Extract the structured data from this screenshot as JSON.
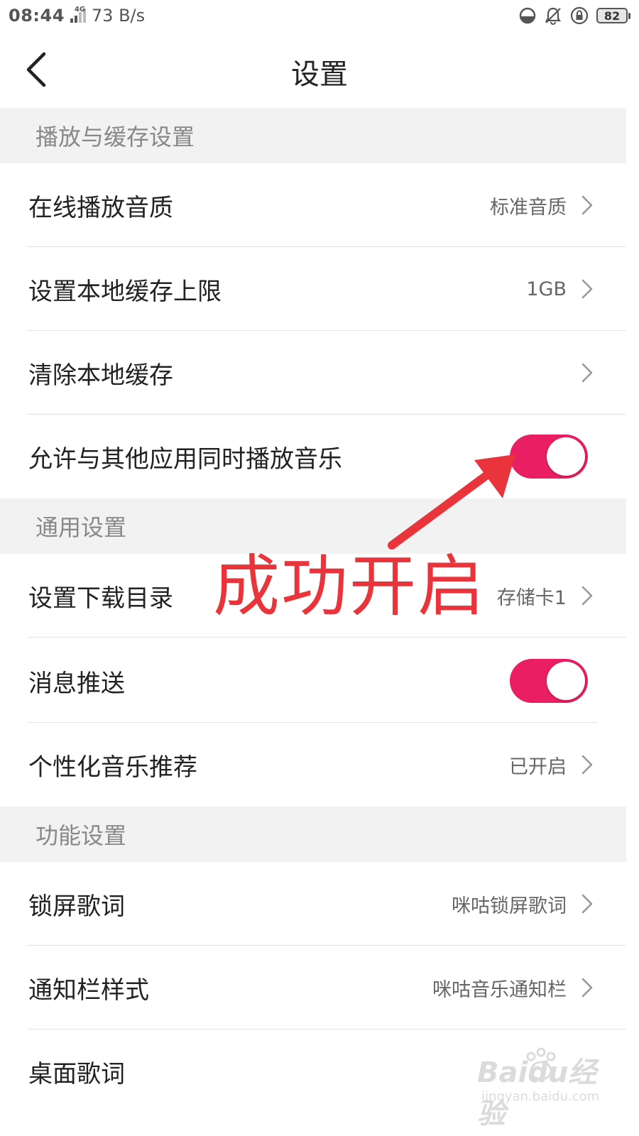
{
  "status_bar": {
    "time": "08:44",
    "network": "4G",
    "speed": "73 B/s",
    "battery": "82",
    "icons": [
      "data-saver-icon",
      "bell-muted-icon",
      "rotation-lock-icon",
      "battery-icon"
    ]
  },
  "header": {
    "title": "设置",
    "back_icon": "chevron-left-icon"
  },
  "sections": {
    "playback": {
      "title": "播放与缓存设置",
      "items": [
        {
          "label": "在线播放音质",
          "value": "标准音质"
        },
        {
          "label": "设置本地缓存上限",
          "value": "1GB"
        },
        {
          "label": "清除本地缓存",
          "value": ""
        },
        {
          "label": "允许与其他应用同时播放音乐",
          "toggle": true
        }
      ]
    },
    "general": {
      "title": "通用设置",
      "items": [
        {
          "label": "设置下载目录",
          "value": "存储卡1"
        },
        {
          "label": "消息推送",
          "toggle": true
        },
        {
          "label": "个性化音乐推荐",
          "value": "已开启"
        }
      ]
    },
    "features": {
      "title": "功能设置",
      "items": [
        {
          "label": "锁屏歌词",
          "value": "咪咕锁屏歌词"
        },
        {
          "label": "通知栏样式",
          "value": "咪咕音乐通知栏"
        },
        {
          "label": "桌面歌词",
          "value": ""
        }
      ]
    }
  },
  "annotation": {
    "text": "成功开启",
    "color": "#e8343a"
  },
  "watermark": {
    "main": "Baidu经验",
    "sub": "jingyan.baidu.com"
  },
  "colors": {
    "accent": "#e91e63",
    "section_bg": "#f2f2f2",
    "divider": "#e2e2e2"
  }
}
